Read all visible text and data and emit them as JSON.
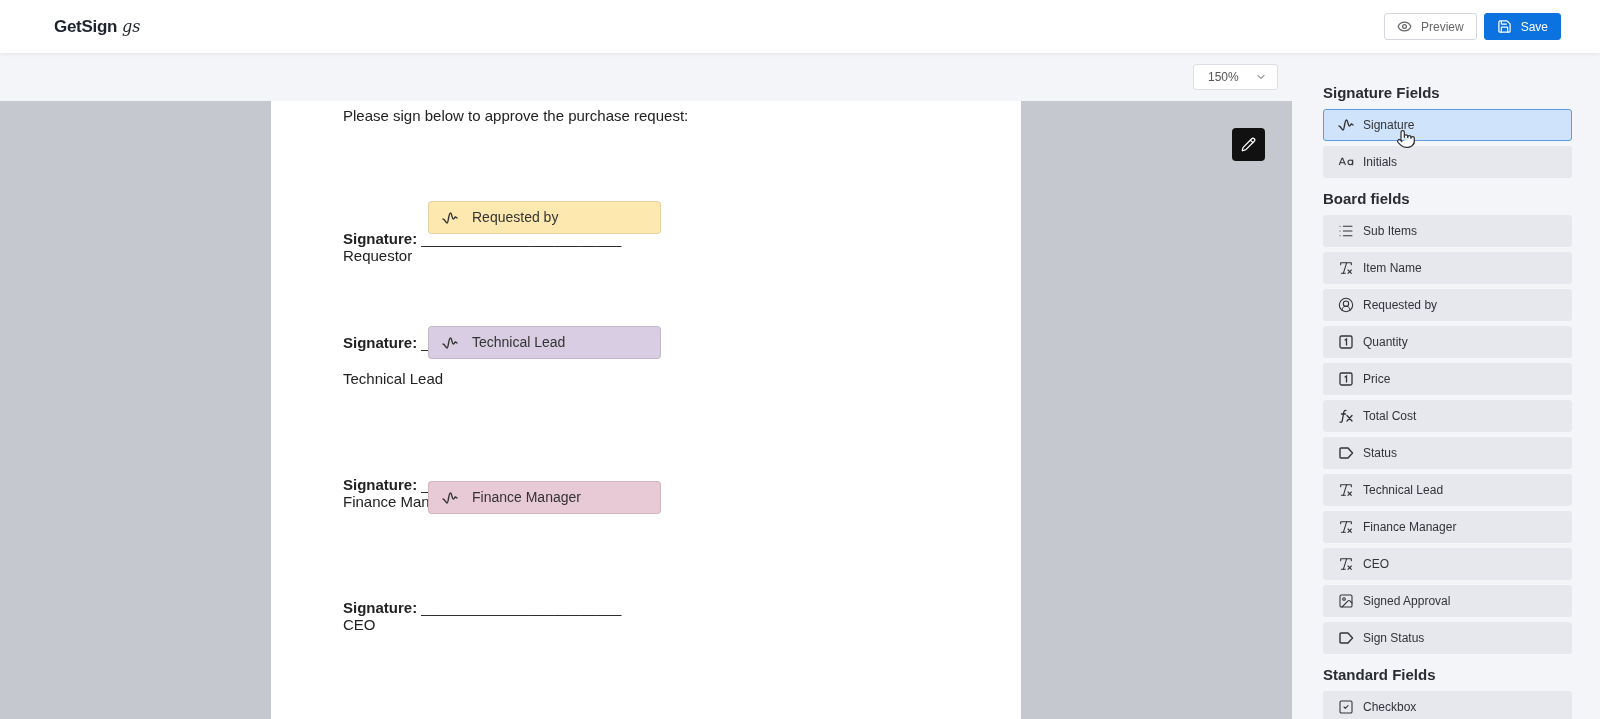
{
  "header": {
    "logo": {
      "name": "GetSign",
      "mark": "gs"
    },
    "buttons": [
      {
        "label": "Preview",
        "kind": "preview"
      },
      {
        "label": "Save",
        "kind": "save"
      }
    ]
  },
  "toolbar": {
    "zoom": "150%"
  },
  "document": {
    "intro": "Please sign below to approve the purchase request:",
    "blocks": [
      {
        "label": "Signature:",
        "line": "________________________",
        "role": "Requestor",
        "field": {
          "label": "Requested by",
          "color": "#fde9b0"
        }
      },
      {
        "label": "Signature:",
        "line": "_",
        "role": "Technical Lead",
        "field": {
          "label": "Technical Lead",
          "color": "#d8cde2"
        }
      },
      {
        "label": "Signature:",
        "line": "_",
        "role": "Finance Man",
        "field": {
          "label": "Finance Manager",
          "color": "#e8c9d6"
        }
      },
      {
        "label": "Signature:",
        "line": "________________________",
        "role": "CEO"
      }
    ]
  },
  "sidebar": {
    "sections": [
      {
        "title": "Signature Fields",
        "items": [
          {
            "label": "Signature",
            "kind": "signature",
            "selected": true
          },
          {
            "label": "Initials",
            "kind": "initials",
            "selected": false
          }
        ]
      },
      {
        "title": "Board fields",
        "items": [
          {
            "label": "Sub Items",
            "kind": "list",
            "selected": false
          },
          {
            "label": "Item Name",
            "kind": "text",
            "selected": false
          },
          {
            "label": "Requested by",
            "kind": "person",
            "selected": false
          },
          {
            "label": "Quantity",
            "kind": "number",
            "selected": false
          },
          {
            "label": "Price",
            "kind": "number",
            "selected": false
          },
          {
            "label": "Total Cost",
            "kind": "formula",
            "selected": false
          },
          {
            "label": "Status",
            "kind": "status",
            "selected": false
          },
          {
            "label": "Technical Lead",
            "kind": "text",
            "selected": false
          },
          {
            "label": "Finance Manager",
            "kind": "text",
            "selected": false
          },
          {
            "label": "CEO",
            "kind": "text",
            "selected": false
          },
          {
            "label": "Signed Approval",
            "kind": "image",
            "selected": false
          },
          {
            "label": "Sign Status",
            "kind": "status",
            "selected": false
          }
        ]
      },
      {
        "title": "Standard Fields",
        "items": [
          {
            "label": "Checkbox",
            "kind": "checkbox",
            "selected": false
          }
        ]
      }
    ]
  }
}
